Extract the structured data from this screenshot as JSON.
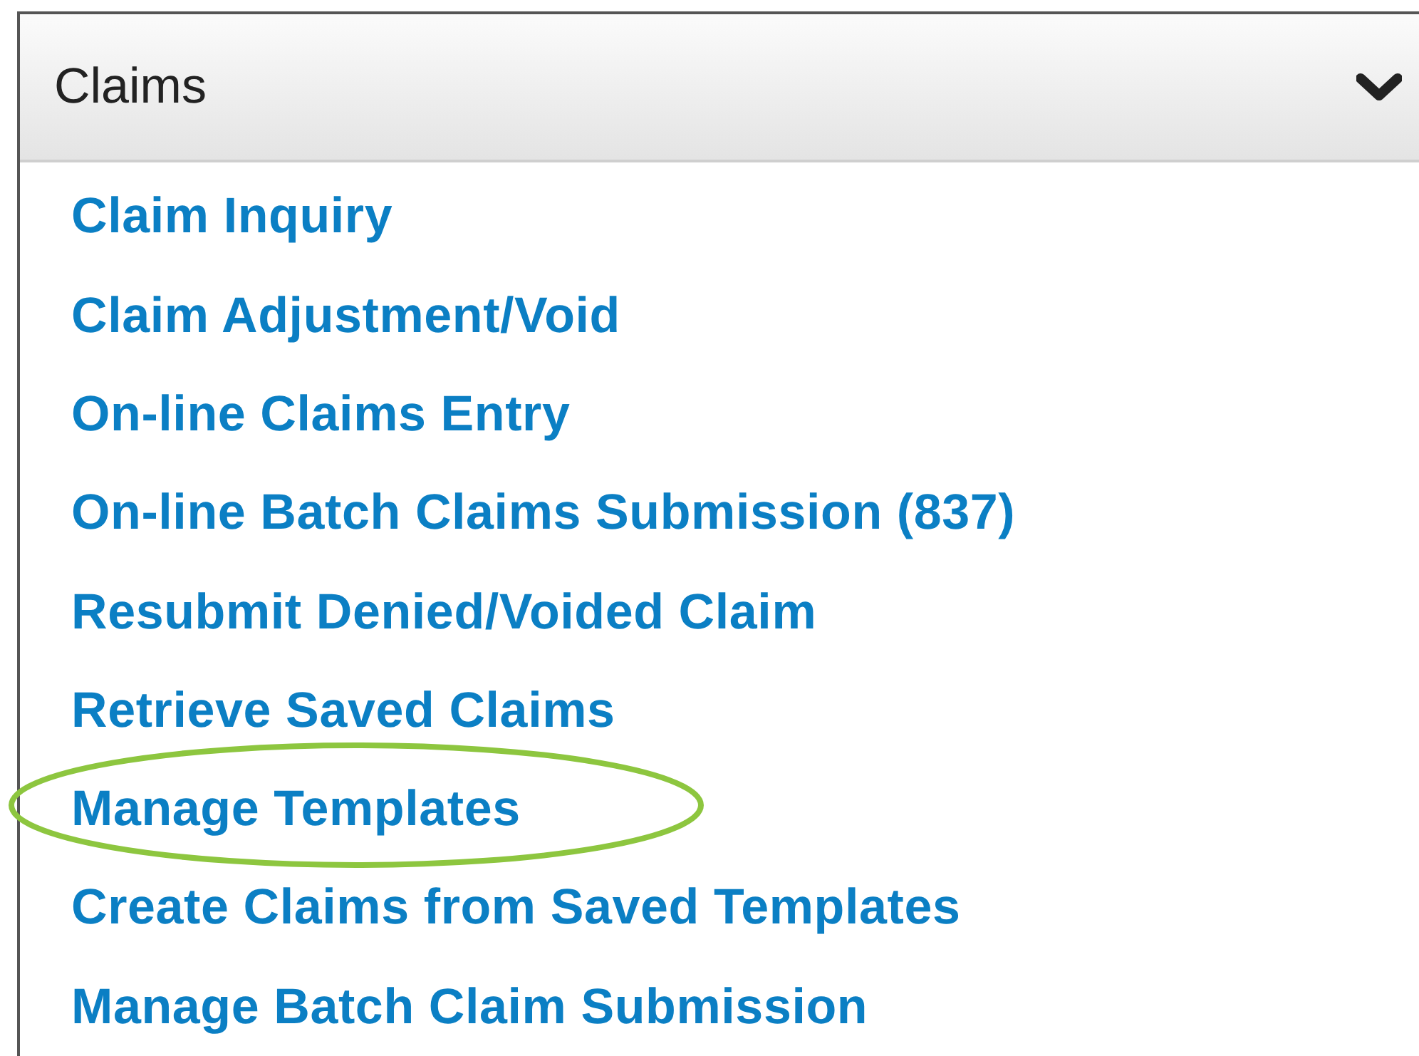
{
  "panel": {
    "title": "Claims",
    "expanded": true
  },
  "items": [
    {
      "label": "Claim Inquiry",
      "highlighted": false
    },
    {
      "label": "Claim Adjustment/Void",
      "highlighted": false
    },
    {
      "label": "On-line Claims Entry",
      "highlighted": false
    },
    {
      "label": "On-line Batch Claims Submission (837)",
      "highlighted": false
    },
    {
      "label": "Resubmit Denied/Voided Claim",
      "highlighted": false
    },
    {
      "label": "Retrieve Saved Claims",
      "highlighted": false
    },
    {
      "label": "Manage Templates",
      "highlighted": true
    },
    {
      "label": "Create Claims from Saved Templates",
      "highlighted": false
    },
    {
      "label": "Manage Batch Claim Submission",
      "highlighted": false
    }
  ]
}
